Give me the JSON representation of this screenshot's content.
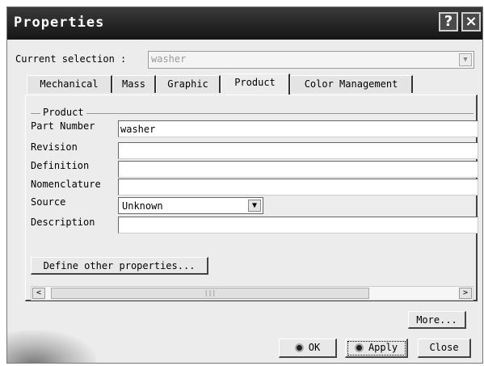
{
  "window": {
    "title": "Properties"
  },
  "titlebar": {
    "help_glyph": "?",
    "close_glyph": "×"
  },
  "selection": {
    "label": "Current selection :",
    "value": "washer"
  },
  "tabs": [
    {
      "label": "Mechanical"
    },
    {
      "label": "Mass"
    },
    {
      "label": "Graphic"
    },
    {
      "label": "Product"
    },
    {
      "label": "Color Management"
    }
  ],
  "product_group": {
    "legend": "Product",
    "part_number_label": "Part Number",
    "part_number_value": "washer",
    "revision_label": "Revision",
    "revision_value": "",
    "definition_label": "Definition",
    "definition_value": "",
    "nomenclature_label": "Nomenclature",
    "nomenclature_value": "",
    "source_label": "Source",
    "source_value": "Unknown",
    "description_label": "Description",
    "description_value": ""
  },
  "define_button": "Define other properties...",
  "scrollbar": {
    "left_glyph": "<",
    "right_glyph": ">",
    "grip": "|||"
  },
  "buttons": {
    "more": "More...",
    "ok": "OK",
    "apply": "Apply",
    "close": "Close"
  },
  "colors": {
    "titlebar": "#1f1f1f",
    "dialog_bg": "#ececec"
  }
}
